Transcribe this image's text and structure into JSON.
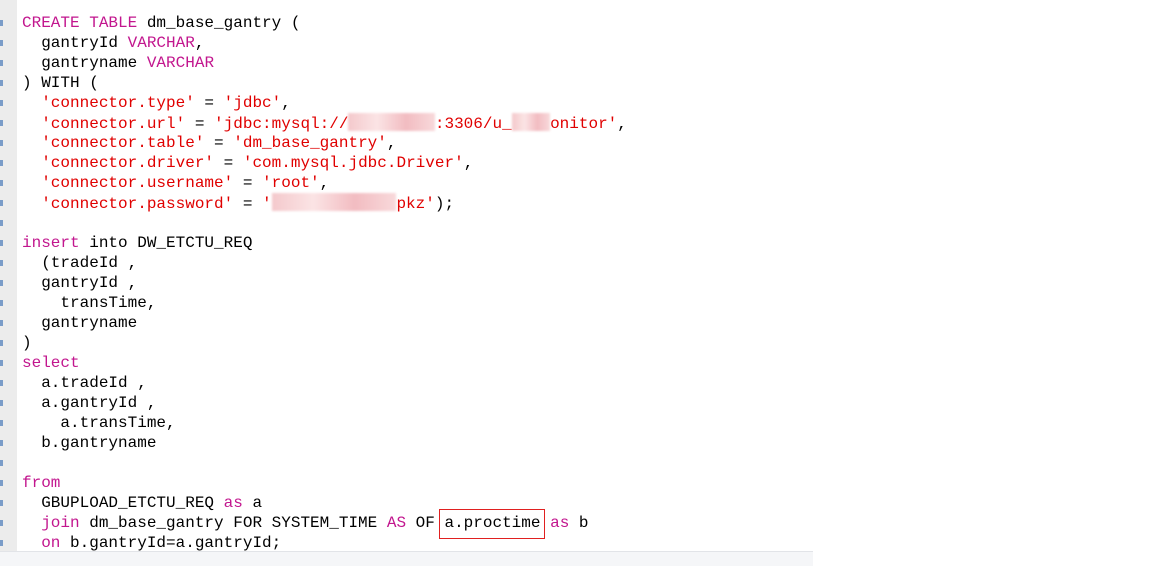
{
  "editor": {
    "language": "sql",
    "colors": {
      "keyword": "#c2168e",
      "string": "#e00000",
      "text": "#000000",
      "highlight_box": "#e02020"
    },
    "lines": [
      [
        {
          "t": "CREATE TABLE",
          "c": "kw"
        },
        {
          "t": " dm_base_gantry (",
          "c": "txt"
        }
      ],
      [
        {
          "t": "  gantryId ",
          "c": "txt"
        },
        {
          "t": "VARCHAR",
          "c": "kw"
        },
        {
          "t": ",",
          "c": "txt"
        }
      ],
      [
        {
          "t": "  gantryname ",
          "c": "txt"
        },
        {
          "t": "VARCHAR",
          "c": "kw"
        }
      ],
      [
        {
          "t": ") WITH (",
          "c": "txt"
        }
      ],
      [
        {
          "t": "  ",
          "c": "txt"
        },
        {
          "t": "'connector.type'",
          "c": "str"
        },
        {
          "t": " = ",
          "c": "txt"
        },
        {
          "t": "'jdbc'",
          "c": "str"
        },
        {
          "t": ",",
          "c": "txt"
        }
      ],
      [
        {
          "t": "  ",
          "c": "txt"
        },
        {
          "t": "'connector.url'",
          "c": "str"
        },
        {
          "t": " = ",
          "c": "txt"
        },
        {
          "t": "'jdbc:mysql://",
          "c": "str"
        },
        {
          "t": "",
          "c": "redacted",
          "w": 9
        },
        {
          "t": ":3306/u_",
          "c": "str"
        },
        {
          "t": "",
          "c": "redacted",
          "w": 4
        },
        {
          "t": "onitor'",
          "c": "str"
        },
        {
          "t": ",",
          "c": "txt"
        }
      ],
      [
        {
          "t": "  ",
          "c": "txt"
        },
        {
          "t": "'connector.table'",
          "c": "str"
        },
        {
          "t": " = ",
          "c": "txt"
        },
        {
          "t": "'dm_base_gantry'",
          "c": "str"
        },
        {
          "t": ",",
          "c": "txt"
        }
      ],
      [
        {
          "t": "  ",
          "c": "txt"
        },
        {
          "t": "'connector.driver'",
          "c": "str"
        },
        {
          "t": " = ",
          "c": "txt"
        },
        {
          "t": "'com.mysql.jdbc.Driver'",
          "c": "str"
        },
        {
          "t": ",",
          "c": "txt"
        }
      ],
      [
        {
          "t": "  ",
          "c": "txt"
        },
        {
          "t": "'connector.username'",
          "c": "str"
        },
        {
          "t": " = ",
          "c": "txt"
        },
        {
          "t": "'root'",
          "c": "str"
        },
        {
          "t": ",",
          "c": "txt"
        }
      ],
      [
        {
          "t": "  ",
          "c": "txt"
        },
        {
          "t": "'connector.password'",
          "c": "str"
        },
        {
          "t": " = ",
          "c": "txt"
        },
        {
          "t": "'",
          "c": "str"
        },
        {
          "t": "",
          "c": "redacted",
          "w": 13
        },
        {
          "t": "pkz'",
          "c": "str"
        },
        {
          "t": ");",
          "c": "txt"
        }
      ],
      [],
      [
        {
          "t": "insert",
          "c": "kw"
        },
        {
          "t": " into DW_ETCTU_REQ",
          "c": "txt"
        }
      ],
      [
        {
          "t": "  (tradeId ,",
          "c": "txt"
        }
      ],
      [
        {
          "t": "  gantryId ,",
          "c": "txt"
        }
      ],
      [
        {
          "t": "    transTime,",
          "c": "txt"
        }
      ],
      [
        {
          "t": "  gantryname",
          "c": "txt"
        }
      ],
      [
        {
          "t": ")",
          "c": "txt"
        }
      ],
      [
        {
          "t": "select",
          "c": "kw"
        }
      ],
      [
        {
          "t": "  a.tradeId ,",
          "c": "txt"
        }
      ],
      [
        {
          "t": "  a.gantryId ,",
          "c": "txt"
        }
      ],
      [
        {
          "t": "    a.transTime,",
          "c": "txt"
        }
      ],
      [
        {
          "t": "  b.gantryname",
          "c": "txt"
        }
      ],
      [],
      [
        {
          "t": "from",
          "c": "kw"
        }
      ],
      [
        {
          "t": "  GBUPLOAD_ETCTU_REQ ",
          "c": "txt"
        },
        {
          "t": "as",
          "c": "kw"
        },
        {
          "t": " a",
          "c": "txt"
        }
      ],
      [
        {
          "t": "  ",
          "c": "txt"
        },
        {
          "t": "join",
          "c": "kw"
        },
        {
          "t": " dm_base_gantry FOR SYSTEM_TIME ",
          "c": "txt"
        },
        {
          "t": "AS",
          "c": "kw"
        },
        {
          "t": " OF ",
          "c": "txt"
        },
        {
          "t": "a.proctime",
          "c": "hl"
        },
        {
          "t": " ",
          "c": "txt"
        },
        {
          "t": "as",
          "c": "kw"
        },
        {
          "t": " b",
          "c": "txt"
        }
      ],
      [
        {
          "t": "  ",
          "c": "txt"
        },
        {
          "t": "on",
          "c": "kw"
        },
        {
          "t": " b.gantryId=a.gantryId;",
          "c": "txt"
        }
      ]
    ]
  }
}
